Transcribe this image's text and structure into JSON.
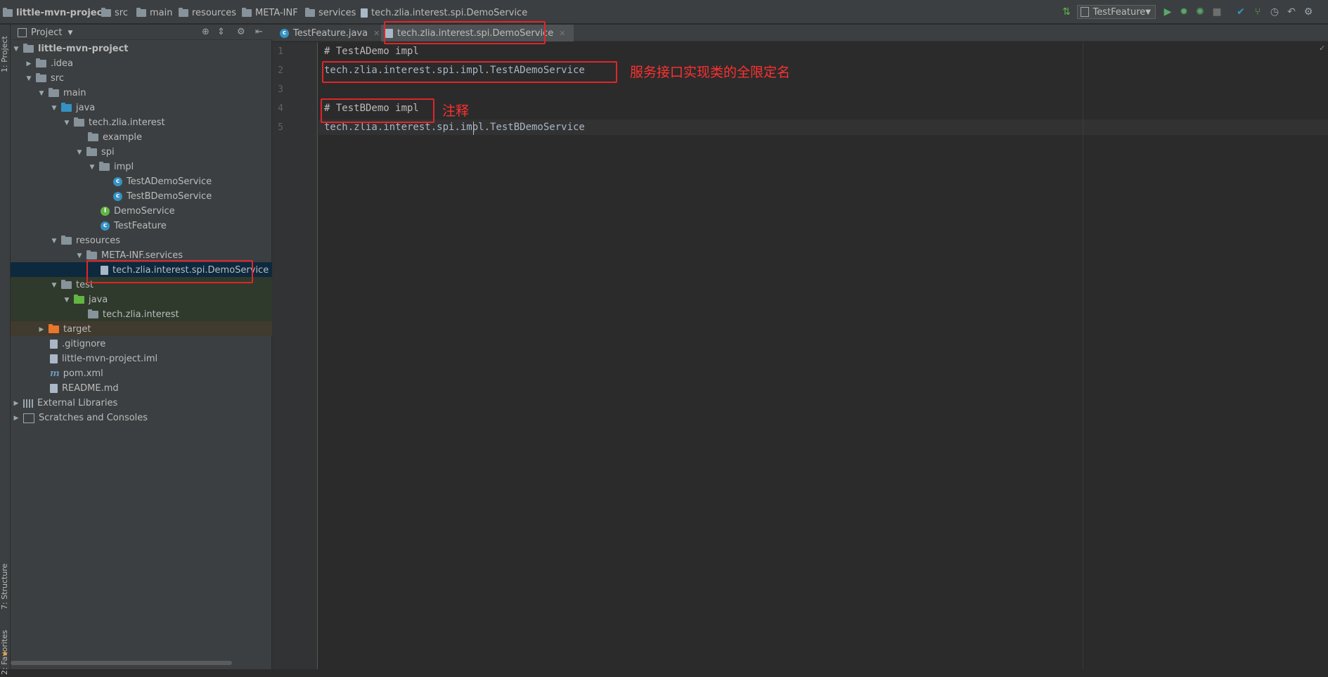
{
  "breadcrumb": [
    "little-mvn-project",
    "src",
    "main",
    "resources",
    "META-INF",
    "services",
    "tech.zlia.interest.spi.DemoService"
  ],
  "run_config": {
    "selected": "TestFeature"
  },
  "left_stripe": {
    "project_tab": "1: Project",
    "structure_tab": "7: Structure",
    "favorites_tab": "2: Favorites"
  },
  "project_panel": {
    "view_label": "Project",
    "tree": [
      {
        "label": "little-mvn-project",
        "icon": "folder-icon"
      },
      {
        "label": ".idea",
        "icon": "folder-icon"
      },
      {
        "label": "src",
        "icon": "folder-icon"
      },
      {
        "label": "main",
        "icon": "folder-icon"
      },
      {
        "label": "java",
        "icon": "source-folder-icon"
      },
      {
        "label": "tech.zlia.interest",
        "icon": "package-icon"
      },
      {
        "label": "example",
        "icon": "package-icon"
      },
      {
        "label": "spi",
        "icon": "package-icon"
      },
      {
        "label": "impl",
        "icon": "package-icon"
      },
      {
        "label": "TestADemoService",
        "icon": "class-icon"
      },
      {
        "label": "TestBDemoService",
        "icon": "class-icon"
      },
      {
        "label": "DemoService",
        "icon": "interface-icon"
      },
      {
        "label": "TestFeature",
        "icon": "class-icon"
      },
      {
        "label": "resources",
        "icon": "resources-folder-icon"
      },
      {
        "label": "META-INF.services",
        "icon": "folder-icon"
      },
      {
        "label": "tech.zlia.interest.spi.DemoService",
        "icon": "file-icon"
      },
      {
        "label": "test",
        "icon": "folder-icon"
      },
      {
        "label": "java",
        "icon": "test-source-folder-icon"
      },
      {
        "label": "tech.zlia.interest",
        "icon": "package-icon"
      },
      {
        "label": "target",
        "icon": "excluded-folder-icon"
      },
      {
        "label": ".gitignore",
        "icon": "file-icon"
      },
      {
        "label": "little-mvn-project.iml",
        "icon": "file-icon"
      },
      {
        "label": "pom.xml",
        "icon": "maven-icon"
      },
      {
        "label": "README.md",
        "icon": "file-icon"
      },
      {
        "label": "External Libraries",
        "icon": "libraries-icon"
      },
      {
        "label": "Scratches and Consoles",
        "icon": "scratches-icon"
      }
    ]
  },
  "editor": {
    "tabs": [
      "TestFeature.java",
      "tech.zlia.interest.spi.DemoService"
    ],
    "line_numbers": [
      "1",
      "2",
      "3",
      "4",
      "5"
    ],
    "lines": [
      "# TestADemo impl",
      "tech.zlia.interest.spi.impl.TestADemoService",
      "",
      "# TestBDemo impl",
      "tech.zlia.interest.spi.impl.TestBDemoService"
    ]
  },
  "annotations": {
    "impl_note": "服务接口实现类的全限定名",
    "comment_note": "注释"
  },
  "colors": {
    "annotation_red": "#e0252a",
    "selected_row": "#0d293e",
    "test_row": "#2f3a2c",
    "excluded_row": "#413a2e"
  }
}
